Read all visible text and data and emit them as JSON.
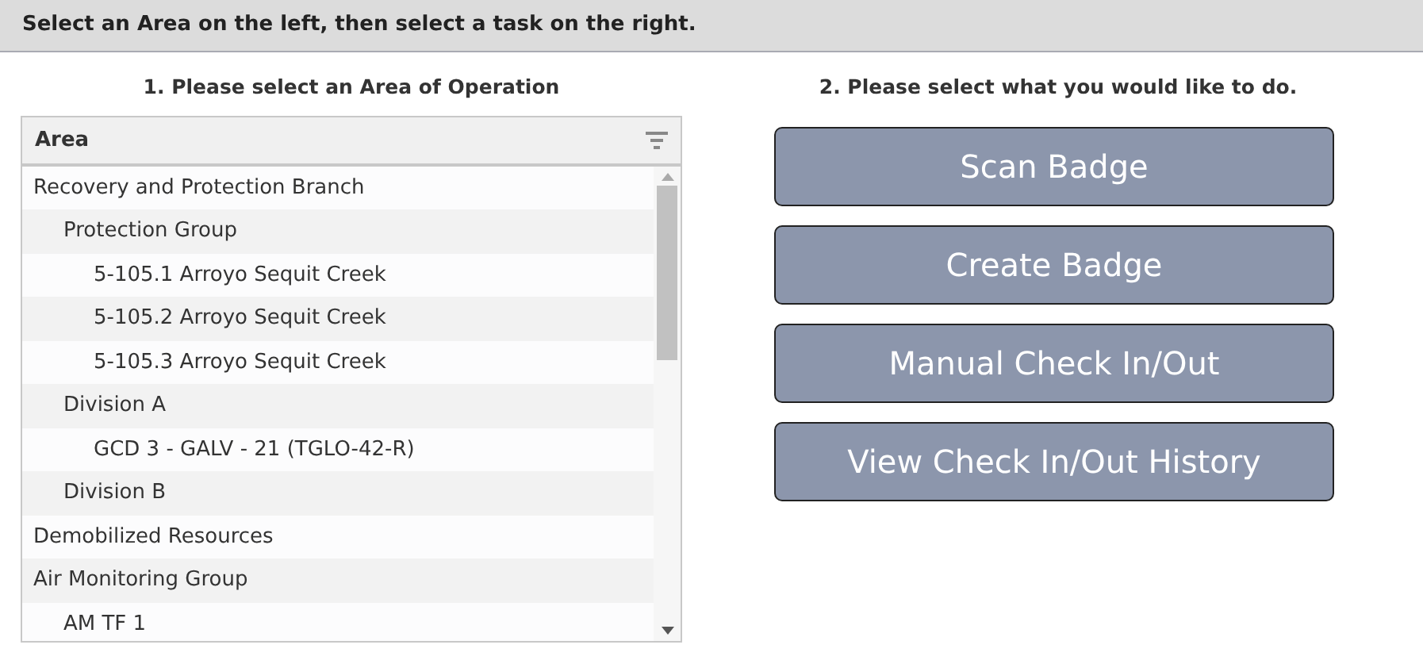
{
  "instruction": "Select an Area on the left, then select a task on the right.",
  "left_heading": "1. Please select an Area of Operation",
  "area_list": {
    "column": "Area",
    "items": [
      {
        "label": "Recovery and Protection Branch",
        "children": [
          {
            "label": "Protection Group",
            "children": [
              {
                "label": "5-105.1 Arroyo Sequit Creek"
              },
              {
                "label": "5-105.2 Arroyo Sequit Creek"
              },
              {
                "label": "5-105.3 Arroyo Sequit Creek"
              }
            ]
          },
          {
            "label": "Division A",
            "children": [
              {
                "label": "GCD 3 - GALV - 21 (TGLO-42-R)"
              }
            ]
          },
          {
            "label": "Division B"
          }
        ]
      },
      {
        "label": "Demobilized Resources"
      },
      {
        "label": "Air Monitoring Group",
        "children": [
          {
            "label": "AM TF 1"
          }
        ]
      }
    ]
  },
  "right_heading": "2. Please select what you would like to do.",
  "actions": [
    "Scan Badge",
    "Create Badge",
    "Manual Check In/Out",
    "View Check In/Out History"
  ]
}
